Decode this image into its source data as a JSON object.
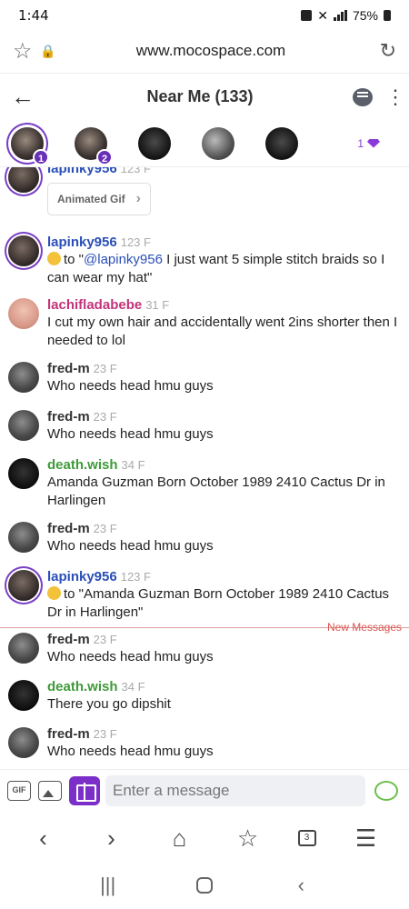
{
  "status": {
    "time": "1:44",
    "battery": "75%"
  },
  "browser": {
    "url": "www.mocospace.com",
    "tabs_count": "3"
  },
  "header": {
    "title": "Near Me (133)"
  },
  "avatars": {
    "badges": [
      "1",
      "2"
    ],
    "gem_count": "1"
  },
  "feed": {
    "gif_label": "Animated Gif",
    "new_messages_label": "New Messages",
    "messages": [
      {
        "user": "lapinky956",
        "meta": "123 F",
        "text": ""
      },
      {
        "user": "lapinky956",
        "meta": "123 F",
        "to": "to \"",
        "mention": "@lapinky956",
        "text": " I just want 5 simple stitch braids so I can wear my hat\""
      },
      {
        "user": "lachifladabebe",
        "meta": "31 F",
        "text": "I cut my own hair and accidentally went 2ins shorter then I needed to lol"
      },
      {
        "user": "fred-m",
        "meta": "23 F",
        "text": "Who needs head hmu guys"
      },
      {
        "user": "fred-m",
        "meta": "23 F",
        "text": "Who needs head hmu guys"
      },
      {
        "user": "death.wish",
        "meta": "34 F",
        "text": "Amanda Guzman Born October 1989 2410 Cactus Dr in Harlingen"
      },
      {
        "user": "fred-m",
        "meta": "23 F",
        "text": "Who needs head hmu guys"
      },
      {
        "user": "lapinky956",
        "meta": "123 F",
        "text": "to \"Amanda Guzman Born October 1989 2410 Cactus Dr in Harlingen\""
      },
      {
        "user": "fred-m",
        "meta": "23 F",
        "text": "Who needs head hmu guys"
      },
      {
        "user": "death.wish",
        "meta": "34 F",
        "text": "There you go dipshit"
      },
      {
        "user": "fred-m",
        "meta": "23 F",
        "text": "Who needs head hmu guys"
      }
    ]
  },
  "composer": {
    "gif_label": "GIF",
    "placeholder": "Enter a message"
  },
  "colors": {
    "accent": "#7b2fc8",
    "username_blue": "#2a4fb8",
    "username_pink": "#c2327a",
    "username_green": "#3f9a3a",
    "new_messages": "#d9544f"
  }
}
